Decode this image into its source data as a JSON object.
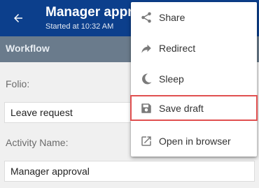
{
  "header": {
    "title": "Manager approval",
    "subtitle": "Started at 10:32 AM",
    "color": "#0c3f8c"
  },
  "section": {
    "title": "Workflow"
  },
  "form": {
    "fields": [
      {
        "label": "Folio:",
        "value": "Leave request"
      },
      {
        "label": "Activity Name:",
        "value": "Manager approval"
      }
    ]
  },
  "menu": {
    "items": [
      {
        "label": "Share",
        "icon": "share-icon"
      },
      {
        "label": "Redirect",
        "icon": "redirect-arrow-icon"
      },
      {
        "label": "Sleep",
        "icon": "moon-icon"
      },
      {
        "label": "Save draft",
        "icon": "floppy-disk-icon",
        "highlighted": true,
        "highlight_color": "#e05050"
      },
      {
        "label": "Open in browser",
        "icon": "open-in-new-icon"
      }
    ]
  }
}
